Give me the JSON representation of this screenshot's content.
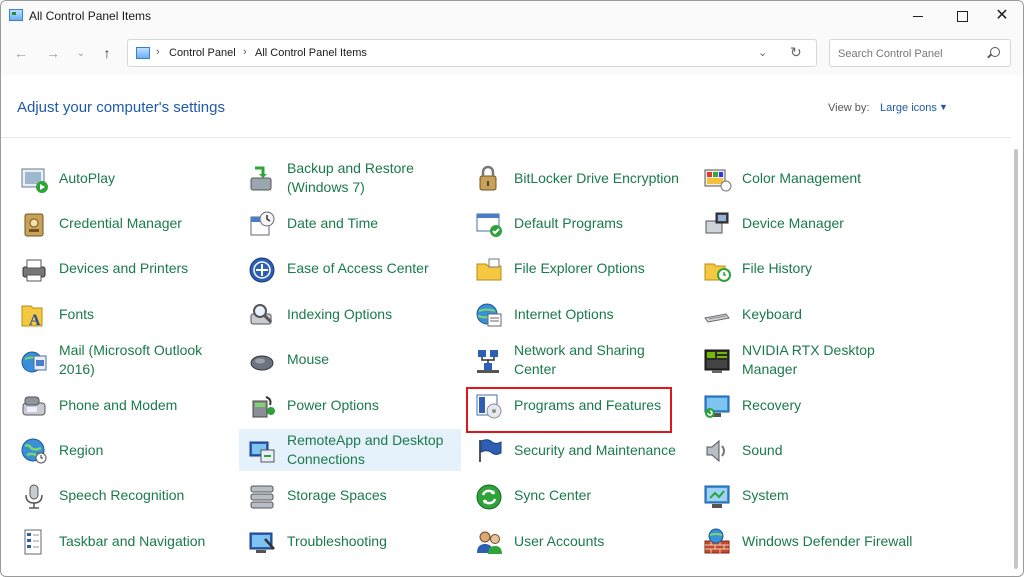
{
  "window": {
    "title": "All Control Panel Items"
  },
  "address": {
    "crumbs": [
      "Control Panel",
      "All Control Panel Items"
    ]
  },
  "search": {
    "placeholder": "Search Control Panel"
  },
  "content": {
    "heading": "Adjust your computer's settings",
    "view_by_label": "View by:",
    "view_by_value": "Large icons"
  },
  "items": [
    {
      "label": "AutoPlay",
      "icon": "autoplay-icon"
    },
    {
      "label": "Backup and Restore (Windows 7)",
      "icon": "backup-restore-icon"
    },
    {
      "label": "BitLocker Drive Encryption",
      "icon": "bitlocker-icon"
    },
    {
      "label": "Color Management",
      "icon": "color-management-icon"
    },
    {
      "label": "Credential Manager",
      "icon": "credential-manager-icon"
    },
    {
      "label": "Date and Time",
      "icon": "date-time-icon"
    },
    {
      "label": "Default Programs",
      "icon": "default-programs-icon"
    },
    {
      "label": "Device Manager",
      "icon": "device-manager-icon"
    },
    {
      "label": "Devices and Printers",
      "icon": "devices-printers-icon"
    },
    {
      "label": "Ease of Access Center",
      "icon": "ease-of-access-icon"
    },
    {
      "label": "File Explorer Options",
      "icon": "file-explorer-options-icon"
    },
    {
      "label": "File History",
      "icon": "file-history-icon"
    },
    {
      "label": "Fonts",
      "icon": "fonts-icon"
    },
    {
      "label": "Indexing Options",
      "icon": "indexing-options-icon"
    },
    {
      "label": "Internet Options",
      "icon": "internet-options-icon"
    },
    {
      "label": "Keyboard",
      "icon": "keyboard-icon"
    },
    {
      "label": "Mail (Microsoft Outlook 2016)",
      "icon": "mail-icon"
    },
    {
      "label": "Mouse",
      "icon": "mouse-icon"
    },
    {
      "label": "Network and Sharing Center",
      "icon": "network-sharing-icon"
    },
    {
      "label": "NVIDIA RTX Desktop Manager",
      "icon": "nvidia-icon"
    },
    {
      "label": "Phone and Modem",
      "icon": "phone-modem-icon"
    },
    {
      "label": "Power Options",
      "icon": "power-options-icon"
    },
    {
      "label": "Programs and Features",
      "icon": "programs-features-icon"
    },
    {
      "label": "Recovery",
      "icon": "recovery-icon"
    },
    {
      "label": "Region",
      "icon": "region-icon"
    },
    {
      "label": "RemoteApp and Desktop Connections",
      "icon": "remoteapp-icon"
    },
    {
      "label": "Security and Maintenance",
      "icon": "security-maintenance-icon"
    },
    {
      "label": "Sound",
      "icon": "sound-icon"
    },
    {
      "label": "Speech Recognition",
      "icon": "speech-recognition-icon"
    },
    {
      "label": "Storage Spaces",
      "icon": "storage-spaces-icon"
    },
    {
      "label": "Sync Center",
      "icon": "sync-center-icon"
    },
    {
      "label": "System",
      "icon": "system-icon"
    },
    {
      "label": "Taskbar and Navigation",
      "icon": "taskbar-icon"
    },
    {
      "label": "Troubleshooting",
      "icon": "troubleshooting-icon"
    },
    {
      "label": "User Accounts",
      "icon": "user-accounts-icon"
    },
    {
      "label": "Windows Defender Firewall",
      "icon": "firewall-icon"
    }
  ],
  "colors": {
    "link_green": "#1a7a4a",
    "heading_blue": "#1e5aa8",
    "highlight_box": "#e0161b",
    "hover_bg": "#e5f1fb"
  }
}
